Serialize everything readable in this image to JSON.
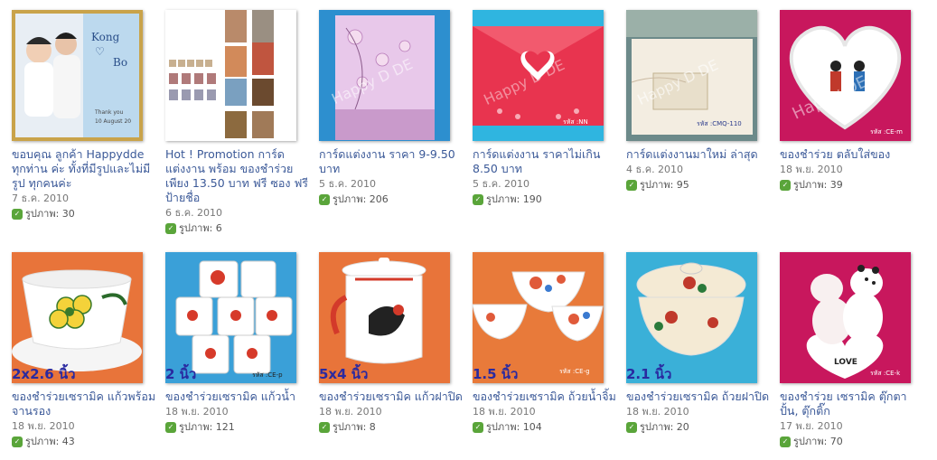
{
  "albums": [
    {
      "title": "ขอบคุณ ลูกค้า Happydde ทุกท่าน ค่ะ ทั้งที่มีรูปและไม่มีรูป ทุกคนค่ะ",
      "date": "7 ธ.ค. 2010",
      "count_label": "รูปภาพ: 30",
      "thumb": "wedding-couple-photo",
      "thumb_text": "Kong"
    },
    {
      "title": "Hot ! Promotion การ์ดแต่งงาน พร้อม ของชำร่วย เพียง 13.50 บาท ฟรี ซอง ฟรี ป้ายชื่อ",
      "date": "6 ธ.ค. 2010",
      "count_label": "รูปภาพ: 6",
      "thumb": "promotion-collage"
    },
    {
      "title": "การ์ดแต่งงาน ราคา 9-9.50 บาท",
      "date": "5 ธ.ค. 2010",
      "count_label": "รูปภาพ: 206",
      "thumb": "floral-card",
      "thumb_text": "Happy D DE"
    },
    {
      "title": "การ์ดแต่งงาน ราคาไม่เกิน 8.50 บาท",
      "date": "5 ธ.ค. 2010",
      "count_label": "รูปภาพ: 190",
      "thumb": "red-heart-card",
      "thumb_text": "Happy D DE"
    },
    {
      "title": "การ์ดแต่งงานมาใหม่ ล่าสุด",
      "date": "4 ธ.ค. 2010",
      "count_label": "รูปภาพ: 95",
      "thumb": "cream-card",
      "thumb_text": "Happy D DE"
    },
    {
      "title": "ของชำร่วย ตลับใส่ของ",
      "date": "18 พ.ย. 2010",
      "count_label": "รูปภาพ: 39",
      "thumb": "heart-box",
      "thumb_text": "Happy DE"
    },
    {
      "title": "ของชำร่วยเซรามิค แก้วพร้อมจานรอง",
      "date": "18 พ.ย. 2010",
      "count_label": "รูปภาพ: 43",
      "thumb": "cup-saucer",
      "thumb_text": "2x2.6 นิ้ว"
    },
    {
      "title": "ของชำร่วยเซรามิค แก้วน้ำ",
      "date": "18 พ.ย. 2010",
      "count_label": "รูปภาพ: 121",
      "thumb": "rooster-mugs",
      "thumb_text": "2 นิ้ว"
    },
    {
      "title": "ของชำร่วยเซรามิค แก้วฝาปิด",
      "date": "18 พ.ย. 2010",
      "count_label": "รูปภาพ: 8",
      "thumb": "lidded-mug",
      "thumb_text": "5x4 นิ้ว"
    },
    {
      "title": "ของชำร่วยเซรามิค ถ้วยน้ำจิ้ม",
      "date": "18 พ.ย. 2010",
      "count_label": "รูปภาพ: 104",
      "thumb": "dip-bowls",
      "thumb_text": "1.5 นิ้ว"
    },
    {
      "title": "ของชำร่วยเซรามิค ถ้วยฝาปิด",
      "date": "18 พ.ย. 2010",
      "count_label": "รูปภาพ: 20",
      "thumb": "lidded-bowl",
      "thumb_text": "2.1 นิ้ว"
    },
    {
      "title": "ของชำร่วย เซรามิค ตุ๊กตาปั้น, ตุ๊กติ๊ก",
      "date": "17 พ.ย. 2010",
      "count_label": "รูปภาพ: 70",
      "thumb": "couple-figurine",
      "thumb_text": "LOVE"
    }
  ],
  "icons": {
    "photo_count": "photos-icon"
  },
  "colors": {
    "link": "#3b5998",
    "icon_green": "#5aa53a",
    "pink_bg": "#c8175d"
  }
}
